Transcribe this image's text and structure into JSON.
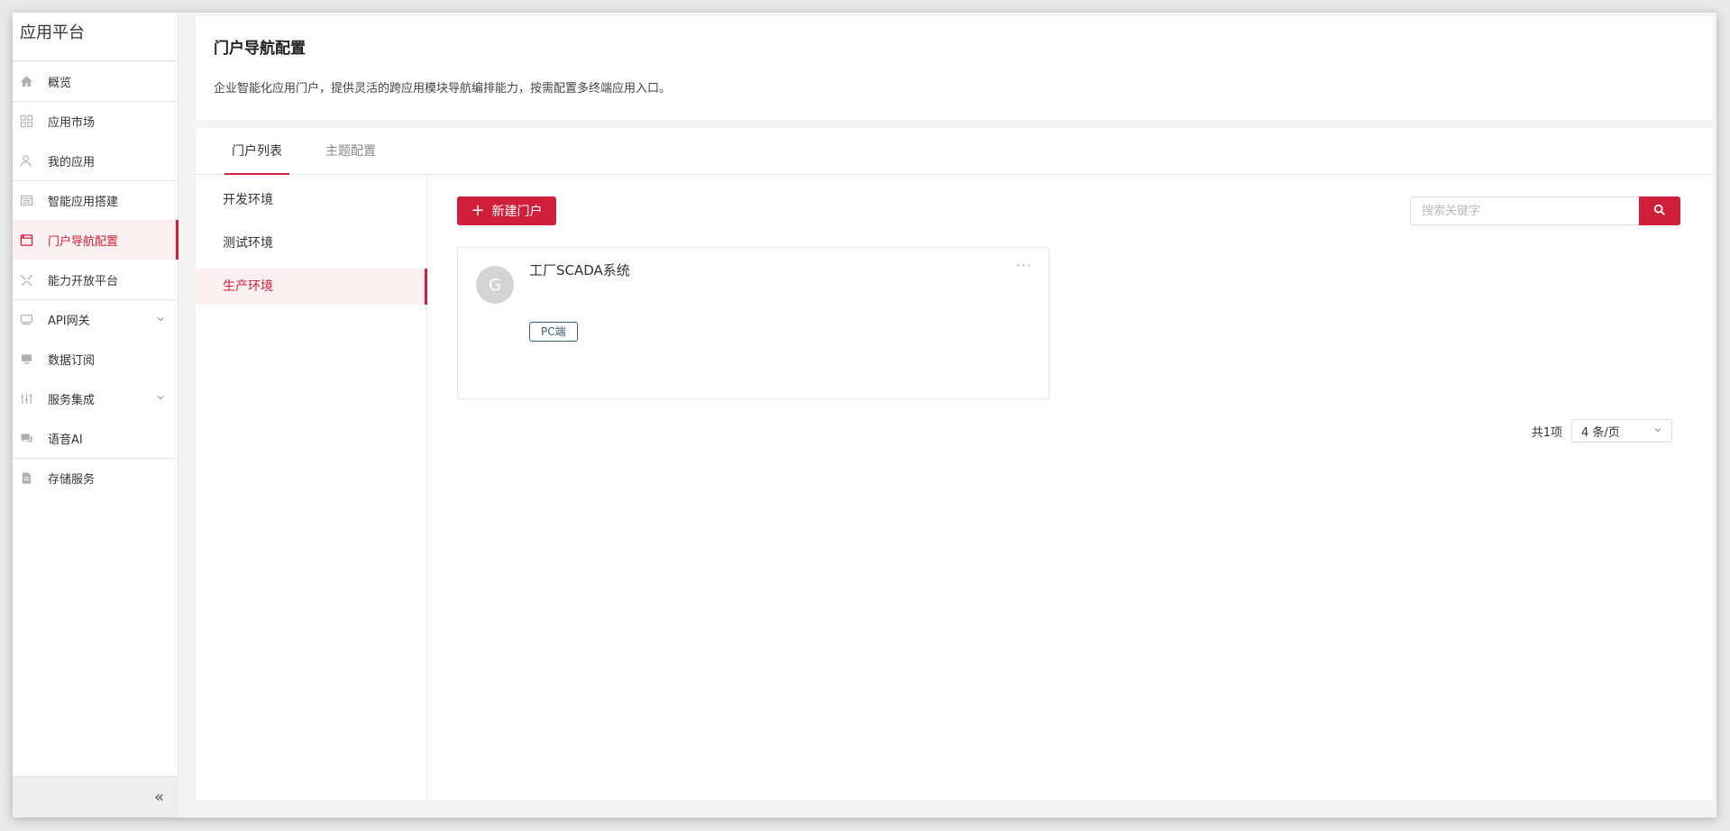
{
  "sidebar": {
    "brand": "应用平台",
    "items": [
      {
        "label": "概览",
        "icon": "home-icon"
      },
      {
        "label": "应用市场",
        "icon": "grid-icon"
      },
      {
        "label": "我的应用",
        "icon": "user-icon"
      },
      {
        "label": "智能应用搭建",
        "icon": "builder-icon"
      },
      {
        "label": "门户导航配置",
        "icon": "window-icon",
        "active": true
      },
      {
        "label": "能力开放平台",
        "icon": "tools-icon"
      },
      {
        "label": "API网关",
        "icon": "server-icon",
        "expandable": true
      },
      {
        "label": "数据订阅",
        "icon": "monitor-icon"
      },
      {
        "label": "服务集成",
        "icon": "sliders-icon",
        "expandable": true
      },
      {
        "label": "语音AI",
        "icon": "chat-icon"
      },
      {
        "label": "存储服务",
        "icon": "file-icon"
      }
    ],
    "collapse_label": "«"
  },
  "header": {
    "title": "门户导航配置",
    "description": "企业智能化应用门户，提供灵活的跨应用模块导航编排能力，按需配置多终端应用入口。"
  },
  "tabs": [
    {
      "label": "门户列表",
      "active": true
    },
    {
      "label": "主题配置"
    }
  ],
  "environments": [
    {
      "label": "开发环境"
    },
    {
      "label": "测试环境"
    },
    {
      "label": "生产环境",
      "active": true
    }
  ],
  "toolbar": {
    "new_label": "新建门户",
    "search_placeholder": "搜索关键字"
  },
  "portals": [
    {
      "avatar": "G",
      "name": "工厂SCADA系统",
      "tag": "PC端",
      "more": "···"
    }
  ],
  "pagination": {
    "total": "共1项",
    "page_size": "4 条/页"
  },
  "colors": {
    "accent": "#cf1f3a",
    "active_bg": "#fdf0f2",
    "tag": "#3b5a82"
  }
}
